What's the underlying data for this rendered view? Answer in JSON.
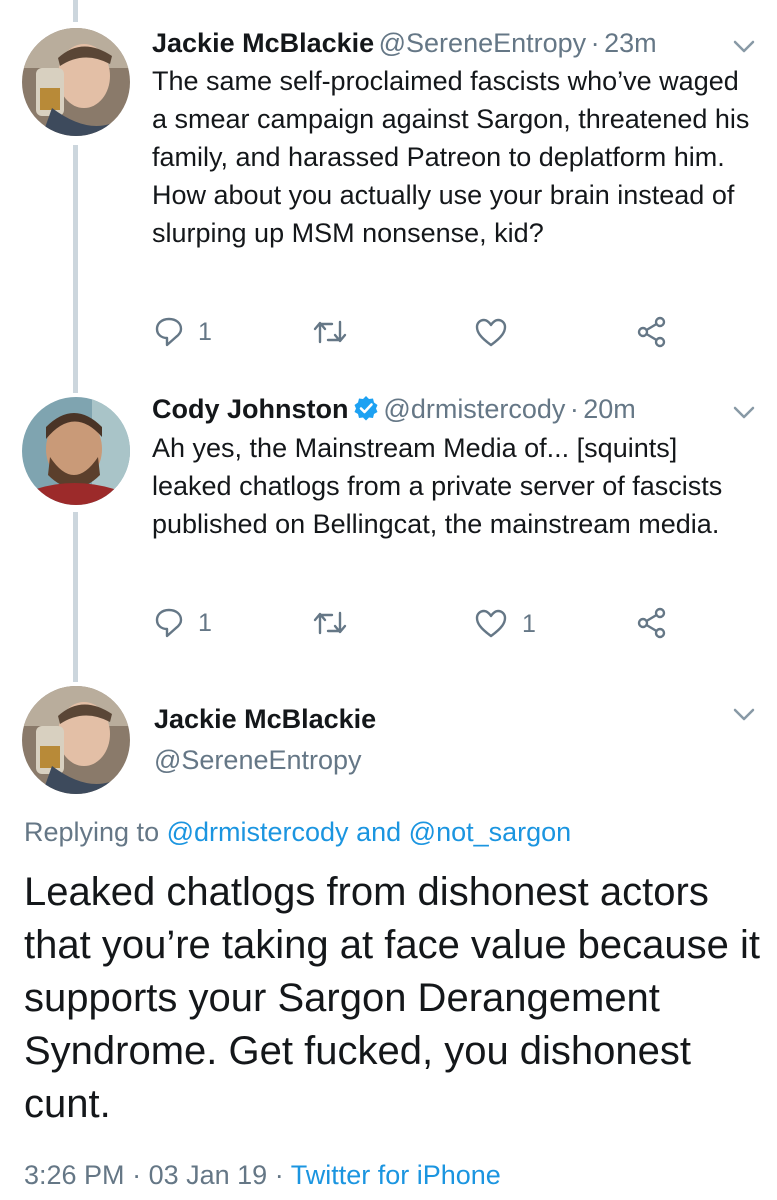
{
  "tweets": [
    {
      "name": "Jackie McBlackie",
      "handle": "@SereneEntropy",
      "time": "23m",
      "text": "The same self-proclaimed fascists who’ve waged a smear campaign against Sargon, threatened his family, and harassed Patreon to deplatform him. How about you actually use your brain instead of slurping up MSM nonsense, kid?",
      "replies": "1",
      "retweets": "",
      "likes": ""
    },
    {
      "name": "Cody Johnston",
      "handle": "@drmistercody",
      "time": "20m",
      "verified": true,
      "text": "Ah yes, the Mainstream Media of... [squints] leaked chatlogs from a private server of fascists published on Bellingcat, the mainstream media.",
      "replies": "1",
      "retweets": "",
      "likes": "1"
    }
  ],
  "main_tweet": {
    "name": "Jackie McBlackie",
    "handle": "@SereneEntropy",
    "replying_prefix": "Replying to",
    "reply_to_1": "@drmistercody",
    "reply_and": "and",
    "reply_to_2": "@not_sargon",
    "text": "Leaked chatlogs from dishonest actors that you’re taking at face value because it supports your Sargon Derangement Syndrome. Get fucked, you dishonest cunt.",
    "time": "3:26 PM",
    "date": "03 Jan 19",
    "source": "Twitter for iPhone"
  },
  "separator": "·",
  "colors": {
    "link": "#1b95e0",
    "muted": "#657786",
    "thread_line": "#ccd6dd",
    "verified": "#1da1f2"
  },
  "icons": [
    "reply-icon",
    "retweet-icon",
    "like-icon",
    "share-icon",
    "chevron-down-icon",
    "verified-badge-icon"
  ]
}
